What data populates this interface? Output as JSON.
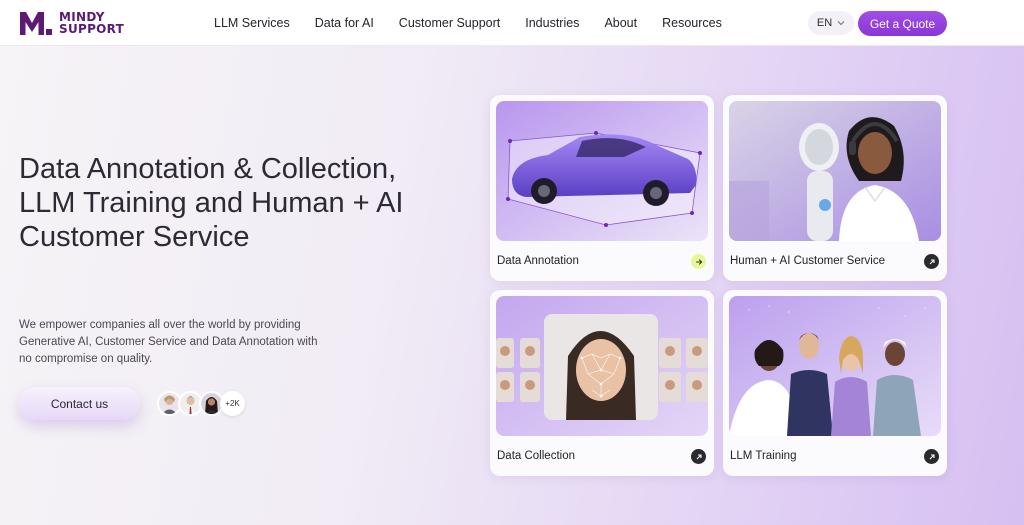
{
  "brand": {
    "line1": "MINDY",
    "line2": "SUPPORT",
    "color": "#5c1a73",
    "logo_icon": "m-logo-icon"
  },
  "nav": [
    {
      "label": "LLM Services"
    },
    {
      "label": "Data for AI"
    },
    {
      "label": "Customer Support"
    },
    {
      "label": "Industries"
    },
    {
      "label": "About"
    },
    {
      "label": "Resources"
    }
  ],
  "header": {
    "language": "EN",
    "quote_button": "Get a Quote"
  },
  "hero": {
    "title": "Data Annotation & Collection, LLM Training and Human + AI Customer Service",
    "description": "We empower companies all over the world by providing Generative AI, Customer Service and Data Annotation with no compromise on quality.",
    "contact_button": "Contact us",
    "avatar_count": "+2K"
  },
  "cards": [
    {
      "label": "Data Annotation",
      "arrow": "arrow-right-icon"
    },
    {
      "label": "Human + AI Customer Service",
      "arrow": "arrow-up-right-icon"
    },
    {
      "label": "Data Collection",
      "arrow": "arrow-up-right-icon"
    },
    {
      "label": "LLM Training",
      "arrow": "arrow-up-right-icon"
    }
  ],
  "colors": {
    "accent": "#9340de",
    "arrow_highlight": "#e6f79a"
  }
}
